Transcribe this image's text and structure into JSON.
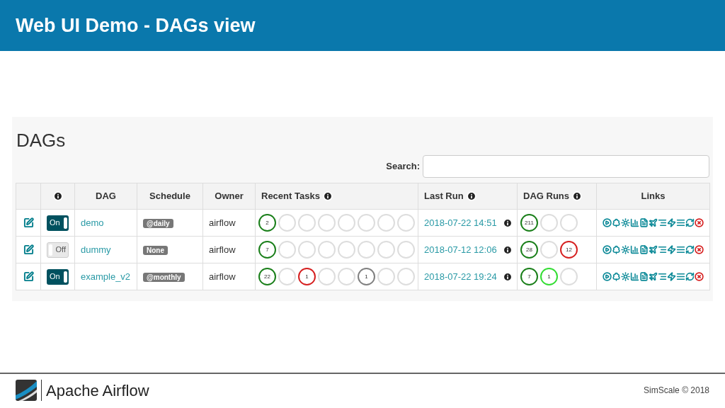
{
  "slide_title": "Web UI Demo - DAGs view",
  "page_title": "DAGs",
  "search": {
    "label": "Search:"
  },
  "table": {
    "columns": [
      "DAG",
      "Schedule",
      "Owner",
      "Recent Tasks",
      "Last Run",
      "DAG Runs",
      "Links"
    ],
    "rows": [
      {
        "on": true,
        "toggle_label": "On",
        "dag": "demo",
        "schedule": "@daily",
        "owner": "airflow",
        "recent_tasks": [
          {
            "count": "2",
            "color": "#1a7f1a"
          },
          {
            "color": "#dddddd"
          },
          {
            "color": "#dddddd"
          },
          {
            "color": "#dddddd"
          },
          {
            "color": "#dddddd"
          },
          {
            "color": "#dddddd"
          },
          {
            "color": "#dddddd"
          },
          {
            "color": "#dddddd"
          }
        ],
        "last_run": "2018-07-22 14:51",
        "dag_runs": [
          {
            "count": "211",
            "color": "#1a7f1a"
          },
          {
            "color": "#dddddd"
          },
          {
            "color": "#dddddd"
          }
        ]
      },
      {
        "on": false,
        "toggle_label": "Off",
        "dag": "dummy",
        "schedule": "None",
        "owner": "airflow",
        "recent_tasks": [
          {
            "count": "7",
            "color": "#1a7f1a"
          },
          {
            "color": "#dddddd"
          },
          {
            "color": "#dddddd"
          },
          {
            "color": "#dddddd"
          },
          {
            "color": "#dddddd"
          },
          {
            "color": "#dddddd"
          },
          {
            "color": "#dddddd"
          },
          {
            "color": "#dddddd"
          }
        ],
        "last_run": "2018-07-12 12:06",
        "dag_runs": [
          {
            "count": "28",
            "color": "#1a7f1a"
          },
          {
            "color": "#dddddd"
          },
          {
            "count": "12",
            "color": "#d62020"
          }
        ]
      },
      {
        "on": true,
        "toggle_label": "On",
        "dag": "example_v2",
        "schedule": "@monthly",
        "owner": "airflow",
        "recent_tasks": [
          {
            "count": "22",
            "color": "#1a7f1a"
          },
          {
            "color": "#dddddd"
          },
          {
            "count": "1",
            "color": "#d62020"
          },
          {
            "color": "#dddddd"
          },
          {
            "color": "#dddddd"
          },
          {
            "count": "1",
            "color": "#808080"
          },
          {
            "color": "#dddddd"
          },
          {
            "color": "#dddddd"
          }
        ],
        "last_run": "2018-07-22 19:24",
        "dag_runs": [
          {
            "count": "7",
            "color": "#1a7f1a"
          },
          {
            "count": "1",
            "color": "#33dd33"
          },
          {
            "color": "#dddddd"
          }
        ]
      }
    ]
  },
  "footer": {
    "brand": "Apache Airflow",
    "credit": "SimScale © 2018"
  }
}
